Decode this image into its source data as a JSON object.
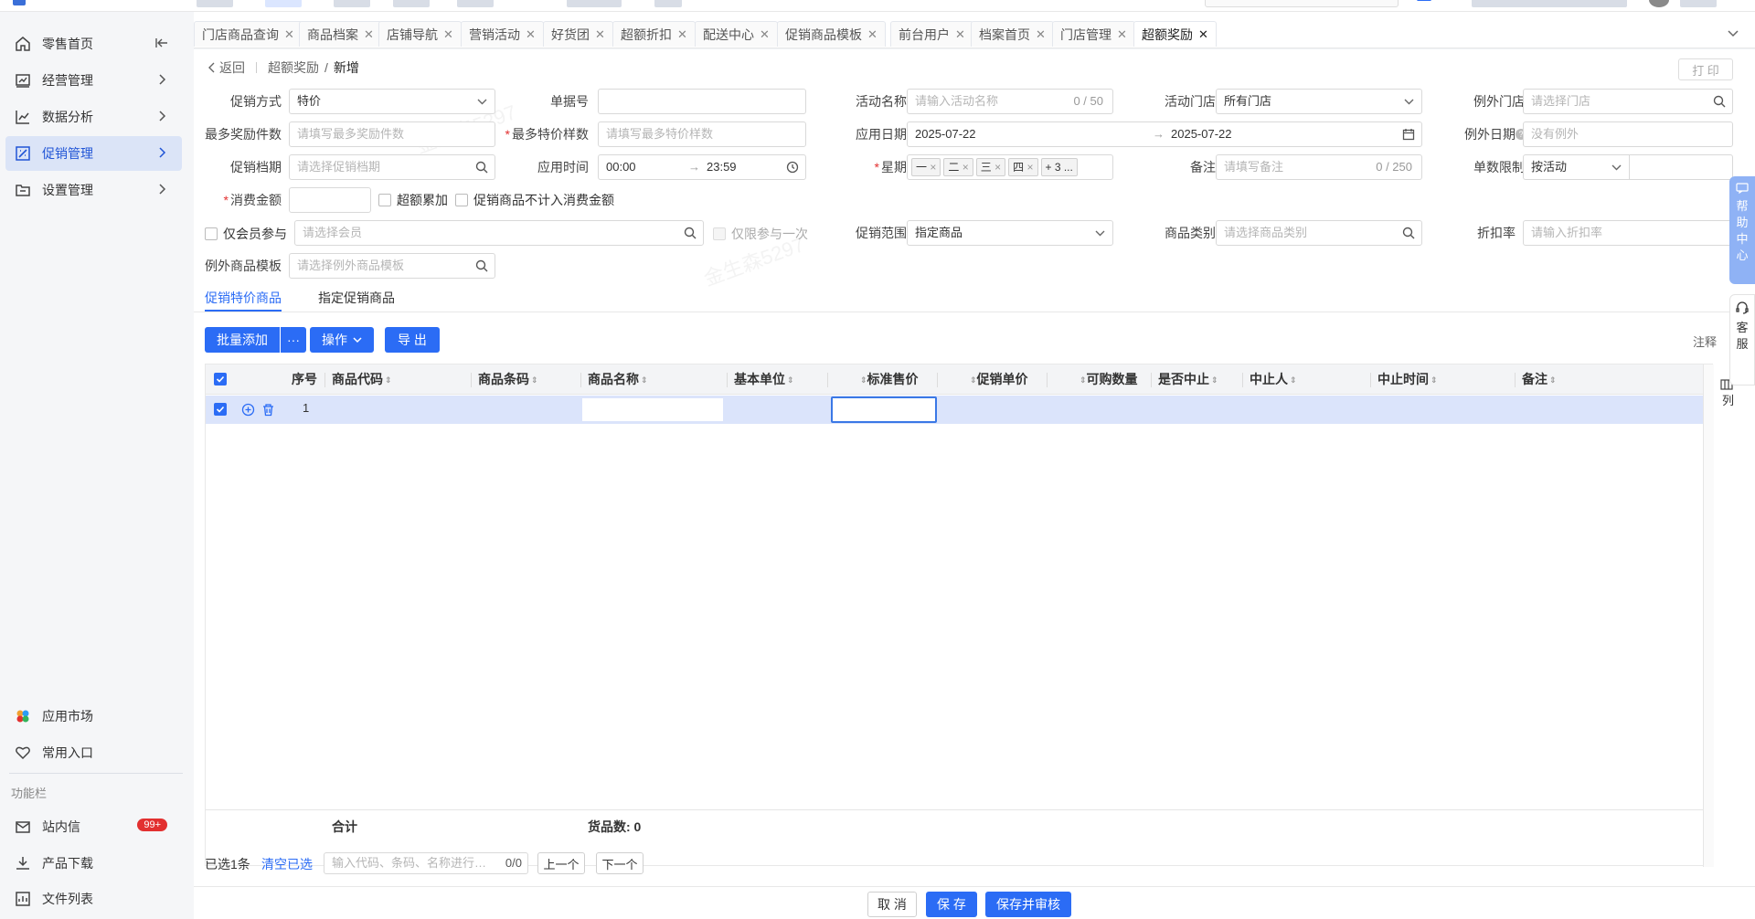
{
  "sidebar": {
    "items": [
      {
        "label": "零售首页",
        "icon": "home-icon"
      },
      {
        "label": "经营管理",
        "icon": "chart-board-icon"
      },
      {
        "label": "数据分析",
        "icon": "line-chart-icon"
      },
      {
        "label": "促销管理",
        "icon": "promotion-icon"
      },
      {
        "label": "设置管理",
        "icon": "settings-box-icon"
      }
    ],
    "bottom_items": [
      {
        "label": "应用市场",
        "icon": "app-market-icon"
      },
      {
        "label": "常用入口",
        "icon": "heart-icon"
      }
    ],
    "section_label": "功能栏",
    "func_items": [
      {
        "label": "站内信",
        "icon": "mail-icon",
        "badge": "99+"
      },
      {
        "label": "产品下载",
        "icon": "download-icon"
      },
      {
        "label": "文件列表",
        "icon": "file-list-icon"
      }
    ]
  },
  "tabs": [
    {
      "label": "门店商品查询"
    },
    {
      "label": "商品档案"
    },
    {
      "label": "店铺导航"
    },
    {
      "label": "营销活动"
    },
    {
      "label": "好货团"
    },
    {
      "label": "超额折扣"
    },
    {
      "label": "配送中心"
    },
    {
      "label": "促销商品模板"
    },
    {
      "label": "前台用户"
    },
    {
      "label": "档案首页"
    },
    {
      "label": "门店管理"
    },
    {
      "label": "超额奖励",
      "active": true
    }
  ],
  "breadcrumb": {
    "back": "返回",
    "parent": "超额奖励",
    "sep": "/",
    "current": "新增"
  },
  "print_button": "打 印",
  "form": {
    "promo_method": {
      "label": "促销方式",
      "value": "特价"
    },
    "doc_no": {
      "label": "单据号",
      "value": ""
    },
    "activity_name": {
      "label": "活动名称",
      "placeholder": "请输入活动名称",
      "counter": "0 / 50"
    },
    "activity_store": {
      "label": "活动门店",
      "value": "所有门店"
    },
    "exclude_store": {
      "label": "例外门店",
      "placeholder": "请选择门店"
    },
    "max_reward": {
      "label": "最多奖励件数",
      "placeholder": "请填写最多奖励件数"
    },
    "max_special": {
      "label": "最多特价样数",
      "placeholder": "请填写最多特价样数",
      "required": "*"
    },
    "apply_date": {
      "label": "应用日期",
      "start": "2025-07-22",
      "arrow": "→",
      "end": "2025-07-22"
    },
    "exclude_date": {
      "label": "例外日期",
      "placeholder": "没有例外"
    },
    "promo_period": {
      "label": "促销档期",
      "placeholder": "请选择促销档期"
    },
    "apply_time": {
      "label": "应用时间",
      "start": "00:00",
      "arrow": "→",
      "end": "23:59"
    },
    "weekday": {
      "label": "星期",
      "required": "*",
      "tags": [
        "一",
        "二",
        "三",
        "四"
      ],
      "more": "+ 3 ..."
    },
    "remark": {
      "label": "备注",
      "placeholder": "请填写备注",
      "counter": "0 / 250"
    },
    "qty_limit": {
      "label": "单数限制",
      "value": "按活动"
    },
    "spend_amount": {
      "label": "消费金额",
      "required": "*"
    },
    "excess_accum": {
      "label": "超额累加"
    },
    "exclude_amount": {
      "label": "促销商品不计入消费金额"
    },
    "member_only": {
      "label": "仅会员参与",
      "placeholder": "请选择会员"
    },
    "once_only": {
      "label": "仅限参与一次"
    },
    "promo_scope": {
      "label": "促销范围",
      "value": "指定商品"
    },
    "goods_category": {
      "label": "商品类别",
      "placeholder": "请选择商品类别"
    },
    "discount_rate": {
      "label": "折扣率",
      "placeholder": "请输入折扣率"
    },
    "exclude_template": {
      "label": "例外商品模板",
      "placeholder": "请选择例外商品模板"
    }
  },
  "sub_tabs": [
    {
      "label": "促销特价商品",
      "active": true
    },
    {
      "label": "指定促销商品"
    }
  ],
  "toolbar": {
    "batch_add": "批量添加",
    "more": "···",
    "ops": "操作",
    "export": "导 出",
    "note": "注释"
  },
  "grid": {
    "columns": [
      "序号",
      "商品代码",
      "商品条码",
      "商品名称",
      "基本单位",
      "标准售价",
      "促销单价",
      "可购数量",
      "是否中止",
      "中止人",
      "中止时间",
      "备注"
    ],
    "rows": [
      {
        "index": "1"
      }
    ],
    "footer": {
      "total_label": "合计",
      "count_label": "货品数: 0"
    },
    "col_setting": "列"
  },
  "selection": {
    "selected": "已选1条",
    "clear": "清空已选",
    "search_placeholder": "输入代码、条码、名称进行…",
    "counter": "0/0",
    "prev": "上一个",
    "next": "下一个"
  },
  "actions": {
    "cancel": "取 消",
    "save": "保 存",
    "save_audit": "保存并审核"
  },
  "floats": {
    "help": [
      "帮",
      "助",
      "中",
      "心"
    ],
    "service": [
      "客",
      "服"
    ]
  },
  "watermark": "金生森5297",
  "colors": {
    "primary": "#2b6cf5",
    "active_nav_bg": "#dbe4f7",
    "row_selected_bg": "#dbe4fb",
    "danger": "#e23030"
  }
}
